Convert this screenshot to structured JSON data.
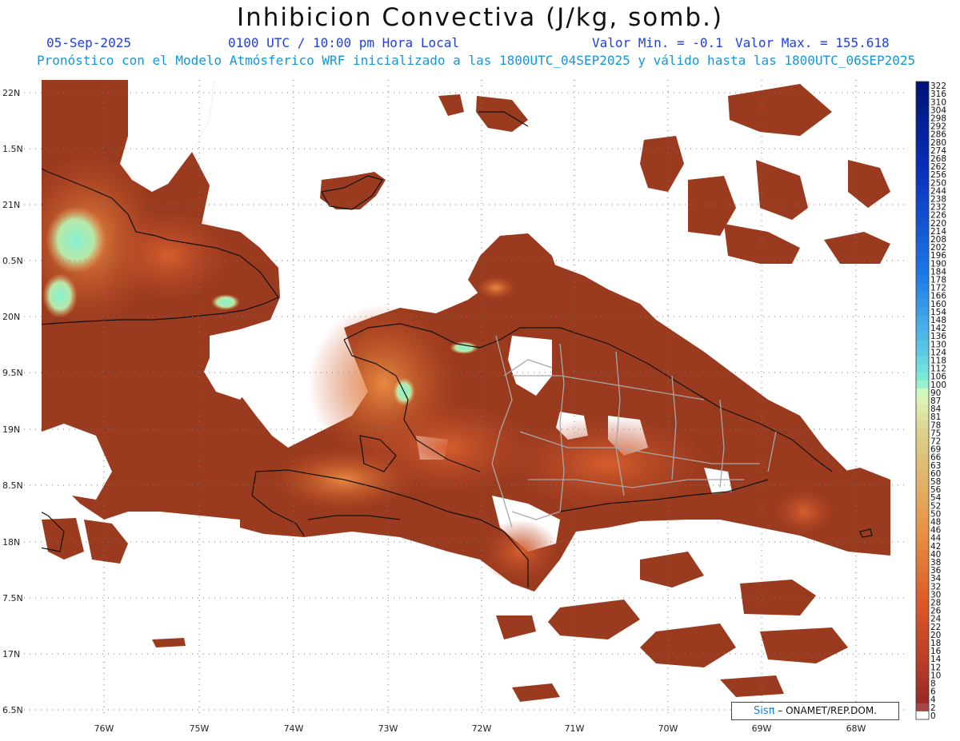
{
  "header": {
    "title": "Inhibicion Convectiva (J/kg, somb.)",
    "date": "05-Sep-2025",
    "time": "0100 UTC / 10:00 pm Hora Local",
    "min_label": "Valor Min. = -0.1",
    "max_label": "Valor Max. = 155.618",
    "subtitle": "Pronóstico con el Modelo Atmósferico WRF inicializado a las 1800UTC_04SEP2025 y válido hasta las  1800UTC_06SEP2025"
  },
  "axes": {
    "lat_labels": [
      "22N",
      "1.5N",
      "21N",
      "0.5N",
      "20N",
      "9.5N",
      "19N",
      "8.5N",
      "18N",
      "7.5N",
      "17N",
      "6.5N"
    ],
    "lon_labels": [
      "76W",
      "75W",
      "74W",
      "73W",
      "72W",
      "71W",
      "70W",
      "69W",
      "68W"
    ]
  },
  "colorbar": {
    "labels": [
      "322",
      "316",
      "310",
      "304",
      "298",
      "292",
      "286",
      "280",
      "274",
      "268",
      "262",
      "256",
      "250",
      "244",
      "238",
      "232",
      "226",
      "220",
      "214",
      "208",
      "202",
      "196",
      "190",
      "184",
      "178",
      "172",
      "166",
      "160",
      "154",
      "148",
      "142",
      "136",
      "130",
      "124",
      "118",
      "112",
      "106",
      "100",
      "90",
      "87",
      "84",
      "81",
      "78",
      "75",
      "72",
      "69",
      "66",
      "63",
      "60",
      "58",
      "56",
      "54",
      "52",
      "50",
      "48",
      "46",
      "44",
      "42",
      "40",
      "38",
      "36",
      "34",
      "32",
      "30",
      "28",
      "26",
      "24",
      "22",
      "20",
      "18",
      "16",
      "14",
      "12",
      "10",
      "8",
      "6",
      "4",
      "2",
      "0"
    ]
  },
  "credit": {
    "brand": "Sisπ",
    "text": "– ONAMET/REP.DOM."
  },
  "colors": {
    "base_field": "#9a3a1e",
    "mid_field": "#d2562a",
    "high_field": "#e8904a",
    "peak_field": "#7ee8c8",
    "header_blue": "#1f3fe0",
    "subtitle_blue": "#1696d8"
  }
}
